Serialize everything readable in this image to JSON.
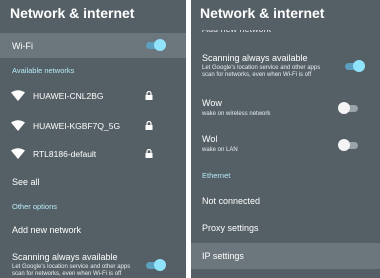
{
  "left": {
    "title": "Network & internet",
    "wifi_label": "Wi-Fi",
    "available_networks_header": "Available networks",
    "networks": [
      {
        "name": "HUAWEI-CNL2BG",
        "locked": true
      },
      {
        "name": "HUAWEI-KGBF7Q_5G",
        "locked": true
      },
      {
        "name": "RTL8186-default",
        "locked": true
      }
    ],
    "see_all": "See all",
    "other_options_header": "Other options",
    "add_new_network": "Add new network",
    "scanning_title": "Scanning always available",
    "scanning_desc_1": "Let Google's location service and other apps",
    "scanning_desc_2": "scan for networks, even when Wi-Fi is off",
    "wifi_toggle_on": true,
    "scanning_toggle_on": true
  },
  "right": {
    "title": "Network & internet",
    "clipped_add_network": "Add new network",
    "scanning_title": "Scanning always available",
    "scanning_desc_1": "Let Google's location service and other apps",
    "scanning_desc_2": "scan for networks, even when Wi-Fi is off",
    "wow_title": "Wow",
    "wow_desc": "wake on wireless network",
    "wol_title": "Wol",
    "wol_desc": "wake on LAN",
    "ethernet_header": "Ethernet",
    "not_connected": "Not connected",
    "proxy_settings": "Proxy settings",
    "ip_settings": "IP settings",
    "scanning_toggle_on": true,
    "wow_toggle_on": false,
    "wol_toggle_on": false
  },
  "colors": {
    "panel_bg": "#556066",
    "highlight_bg": "#6b777d",
    "accent_header": "#b5eaf8",
    "toggle_on_knob": "#8fe3fb"
  },
  "icons": [
    "wifi-icon",
    "lock-icon"
  ]
}
